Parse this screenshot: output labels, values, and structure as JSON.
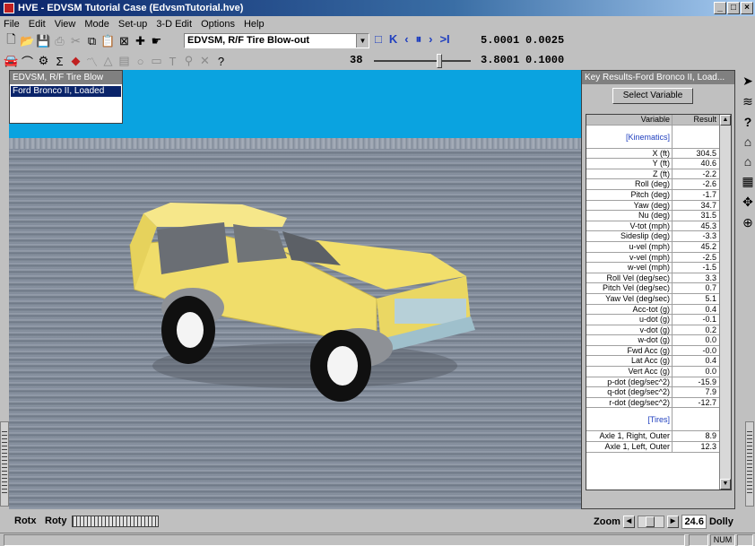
{
  "window": {
    "title": "HVE - EDVSM Tutorial Case (EdvsmTutorial.hve)",
    "btn_min": "_",
    "btn_max": "□",
    "btn_close": "×"
  },
  "menu": [
    "File",
    "Edit",
    "View",
    "Mode",
    "Set-up",
    "3-D Edit",
    "Options",
    "Help"
  ],
  "toolbar": {
    "event_combo": "EDVSM, R/F Tire Blow-out",
    "frame": "38",
    "time_label": "5.0001",
    "time_step": "0.0025",
    "time2": "3.8001",
    "time2_step": "0.1000"
  },
  "vehicle_panel": {
    "header": "EDVSM, R/F Tire Blow",
    "item": "Ford Bronco II, Loaded"
  },
  "results_panel": {
    "header": "Key Results-Ford Bronco II, Load...",
    "select_button": "Select Variable",
    "col_variable": "Variable",
    "col_result": "Result",
    "section1": "[Kinematics]",
    "rows": [
      {
        "variable": "X (ft)",
        "result": "304.5"
      },
      {
        "variable": "Y (ft)",
        "result": "40.6"
      },
      {
        "variable": "Z (ft)",
        "result": "-2.2"
      },
      {
        "variable": "Roll (deg)",
        "result": "-2.6"
      },
      {
        "variable": "Pitch (deg)",
        "result": "-1.7"
      },
      {
        "variable": "Yaw (deg)",
        "result": "34.7"
      },
      {
        "variable": "Nu (deg)",
        "result": "31.5"
      },
      {
        "variable": "V-tot (mph)",
        "result": "45.3"
      },
      {
        "variable": "Sideslip (deg)",
        "result": "-3.3"
      },
      {
        "variable": "u-vel (mph)",
        "result": "45.2"
      },
      {
        "variable": "v-vel (mph)",
        "result": "-2.5"
      },
      {
        "variable": "w-vel (mph)",
        "result": "-1.5"
      },
      {
        "variable": "Roll Vel (deg/sec)",
        "result": "3.3"
      },
      {
        "variable": "Pitch Vel (deg/sec)",
        "result": "0.7"
      },
      {
        "variable": "Yaw Vel (deg/sec)",
        "result": "5.1"
      },
      {
        "variable": "Acc-tot (g)",
        "result": "0.4"
      },
      {
        "variable": "u-dot (g)",
        "result": "-0.1"
      },
      {
        "variable": "v-dot (g)",
        "result": "0.2"
      },
      {
        "variable": "w-dot (g)",
        "result": "0.0"
      },
      {
        "variable": "Fwd Acc (g)",
        "result": "-0.0"
      },
      {
        "variable": "Lat Acc (g)",
        "result": "0.4"
      },
      {
        "variable": "Vert Acc (g)",
        "result": "0.0"
      },
      {
        "variable": "p-dot (deg/sec^2)",
        "result": "-15.9"
      },
      {
        "variable": "q-dot (deg/sec^2)",
        "result": "7.9"
      },
      {
        "variable": "r-dot (deg/sec^2)",
        "result": "-12.7"
      }
    ],
    "section2": "[Tires]",
    "rows2": [
      {
        "variable": "Axle 1, Right, Outer",
        "result": "8.9"
      },
      {
        "variable": "Axle 1, Left, Outer",
        "result": "12.3"
      }
    ]
  },
  "bottom": {
    "rotx": "Rotx",
    "roty": "Roty",
    "zoom": "Zoom",
    "zoom_value": "24.6",
    "dolly": "Dolly"
  },
  "status": {
    "num": "NUM"
  }
}
